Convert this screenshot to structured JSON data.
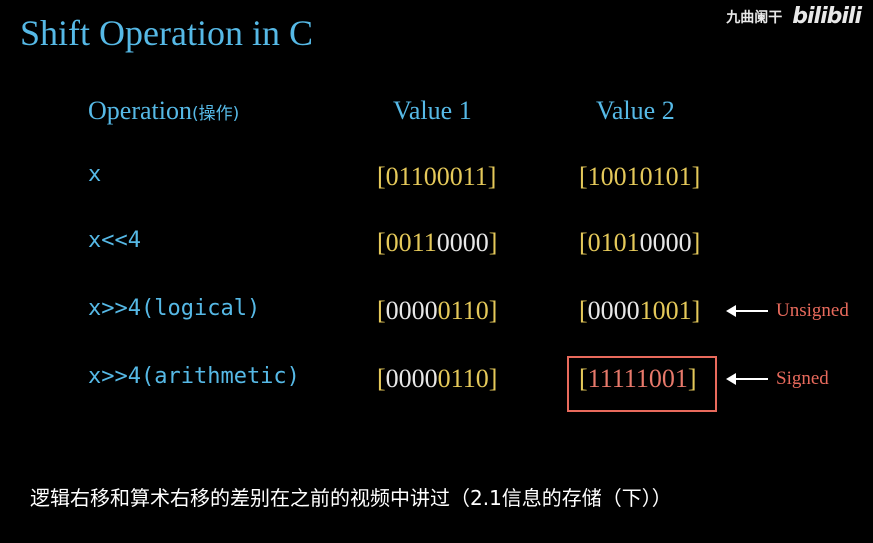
{
  "title": "Shift Operation in C",
  "watermark": {
    "text": "九曲阑干",
    "logo": "bilibili"
  },
  "headers": {
    "operation": "Operation",
    "operation_cn": "(操作)",
    "value1": "Value 1",
    "value2": "Value 2"
  },
  "rows": [
    {
      "op": "x",
      "v1": {
        "open": "[",
        "dim": "",
        "bits": "01100011",
        "close": "]"
      },
      "v2": {
        "open": "[",
        "dim": "",
        "bits": "10010101",
        "close": "]"
      }
    },
    {
      "op": "x<<4",
      "v1": {
        "open": "[",
        "bits_a": "0011",
        "dim": "0000",
        "close": "]"
      },
      "v2": {
        "open": "[",
        "bits_a": "0101",
        "dim": "0000",
        "close": "]"
      }
    },
    {
      "op": "x>>4(logical)",
      "v1": {
        "open": "[",
        "dim": "0000",
        "bits": "0110",
        "close": "]"
      },
      "v2": {
        "open": "[",
        "dim": "0000",
        "bits": "1001",
        "close": "]"
      }
    },
    {
      "op": "x>>4(arithmetic)",
      "v1": {
        "open": "[",
        "dim": "0000",
        "bits": "0110",
        "close": "]"
      },
      "v2": {
        "open": "[",
        "dim": "",
        "bits": "11111001",
        "close": "]"
      }
    }
  ],
  "annotations": {
    "unsigned": "Unsigned",
    "signed": "Signed"
  },
  "subtitle": "逻辑右移和算术右移的差别在之前的视频中讲过（2.1信息的存储（下））",
  "colors": {
    "accent_blue": "#56b9e6",
    "bit_yellow": "#e5c95a",
    "signed_red": "#e86a5c"
  }
}
